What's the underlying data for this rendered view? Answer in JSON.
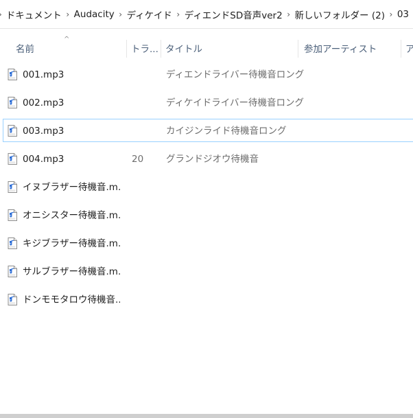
{
  "breadcrumb": [
    "ドキュメント",
    "Audacity",
    "ディケイド",
    "ディエンドSD音声ver2",
    "新しいフォルダー (2)",
    "03"
  ],
  "columns": {
    "name": "名前",
    "track": "トラ...",
    "title": "タイトル",
    "artist": "参加アーティスト",
    "more": "ア"
  },
  "files": [
    {
      "name": "001.mp3",
      "track": "",
      "title": "ディエンドライバー待機音ロング",
      "icon": "mp3-file-icon"
    },
    {
      "name": "002.mp3",
      "track": "",
      "title": "ディケイドライバー待機音ロング",
      "icon": "mp3-file-icon"
    },
    {
      "name": "003.mp3",
      "track": "",
      "title": "カイジンライド待機音ロング",
      "icon": "mp3-file-icon",
      "selected": true
    },
    {
      "name": "004.mp3",
      "track": "20",
      "title": "グランドジオウ待機音",
      "icon": "mp3-file-icon"
    },
    {
      "name": "イヌブラザー待機音.m...",
      "track": "",
      "title": "",
      "icon": "mp3-file-icon"
    },
    {
      "name": "オニシスター待機音.m...",
      "track": "",
      "title": "",
      "icon": "mp3-file-icon"
    },
    {
      "name": "キジブラザー待機音.m...",
      "track": "",
      "title": "",
      "icon": "mp3-file-icon"
    },
    {
      "name": "サルブラザー待機音.m...",
      "track": "",
      "title": "",
      "icon": "mp3-file-icon"
    },
    {
      "name": "ドンモモタロウ待機音....",
      "track": "",
      "title": "",
      "icon": "mp3-file-icon"
    }
  ]
}
